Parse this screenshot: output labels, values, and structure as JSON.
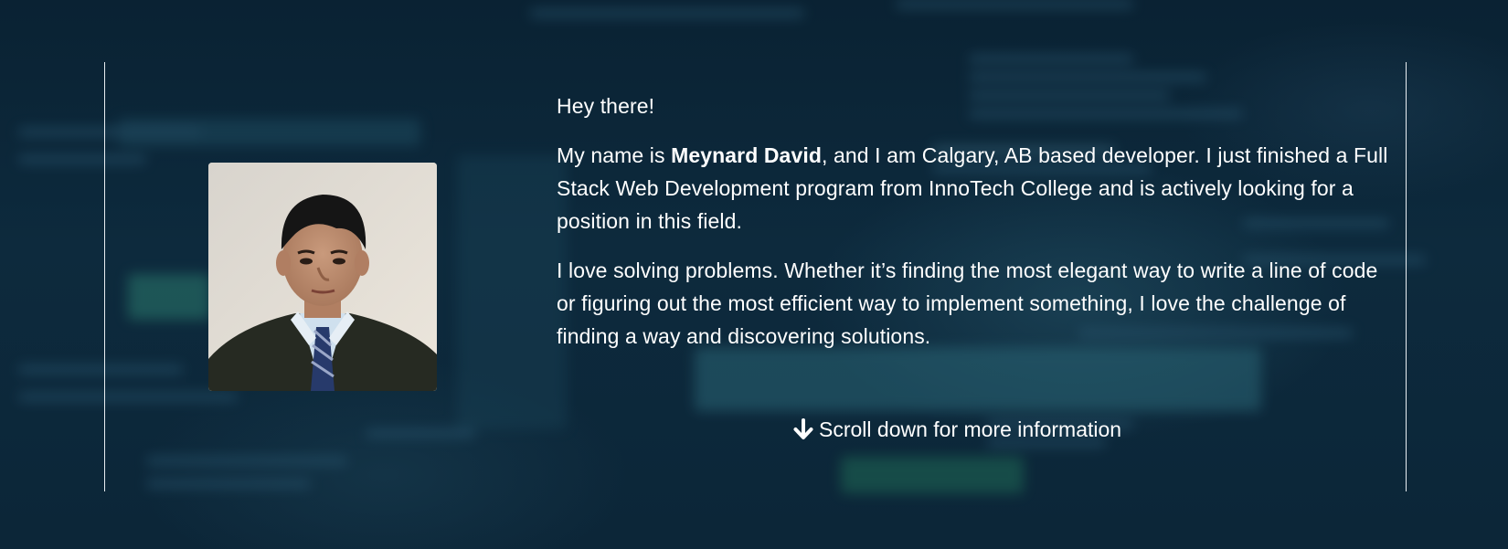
{
  "about": {
    "greeting": "Hey there!",
    "intro_prefix": "My name is ",
    "name": "Meynard David",
    "intro_suffix": ", and I am Calgary, AB based developer. I just finished a Full Stack Web Development program from InnoTech College and is actively looking for a position in this field.",
    "paragraph_2": "I love solving problems. Whether it’s finding the most elegant way to write a line of code or figuring out the most efficient way to implement something, I love the challenge of finding a way and discovering solutions.",
    "scroll_hint": "Scroll down for more information",
    "scroll_icon": "arrow-down-icon",
    "photo_alt": "profile-photo"
  },
  "colors": {
    "background": "#0b2436",
    "text": "#ffffff",
    "frame_lines": "#e9eef2"
  }
}
